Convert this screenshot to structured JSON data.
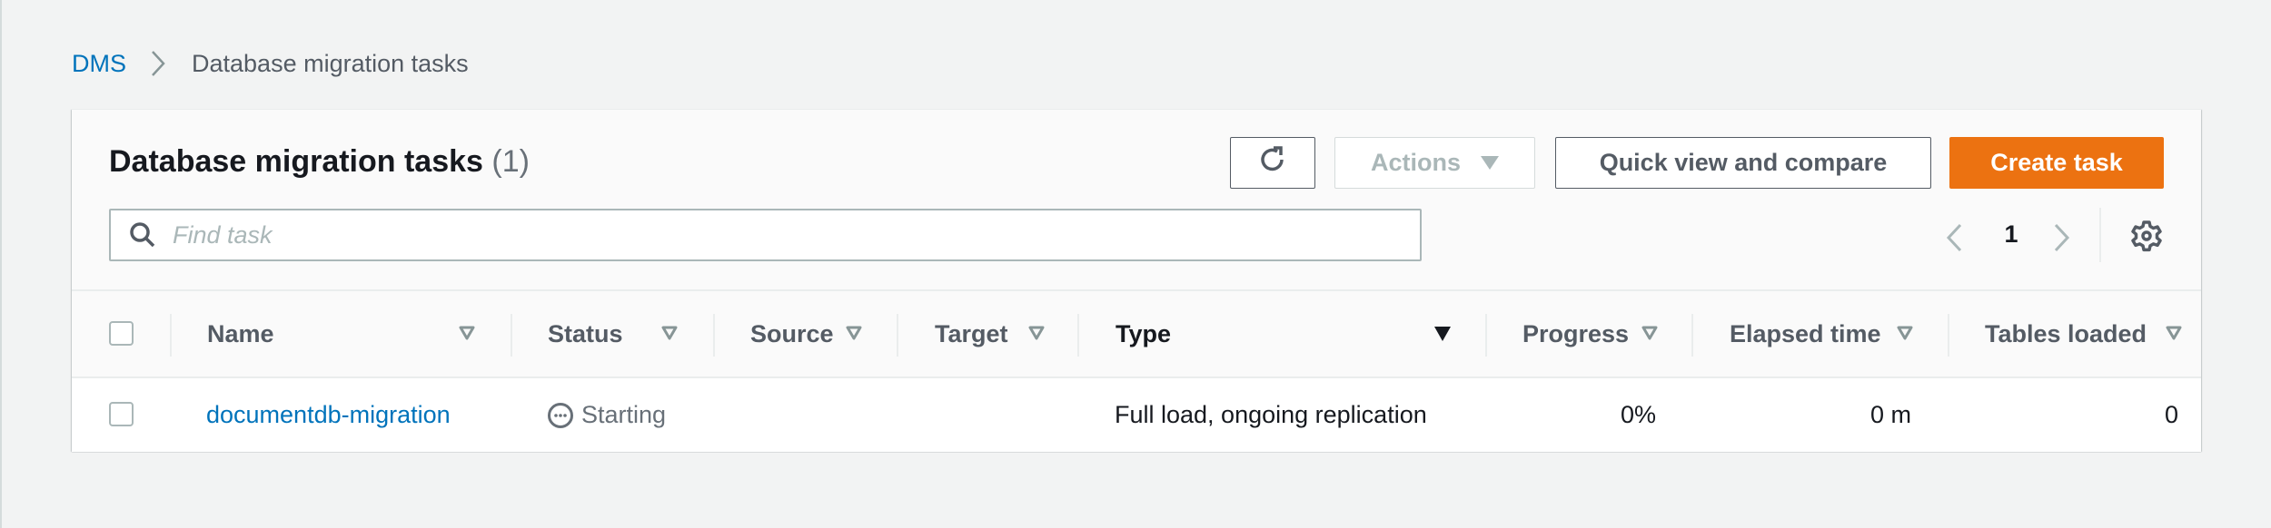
{
  "breadcrumb": {
    "items": [
      {
        "label": "DMS"
      },
      {
        "label": "Database migration tasks"
      }
    ]
  },
  "header": {
    "title": "Database migration tasks",
    "count": "(1)"
  },
  "toolbar": {
    "refresh_icon": "refresh-icon",
    "actions_label": "Actions",
    "quick_view_label": "Quick view and compare",
    "create_label": "Create task"
  },
  "search": {
    "placeholder": "Find task",
    "value": ""
  },
  "pagination": {
    "current_page": "1"
  },
  "table": {
    "columns": [
      {
        "label": "Name",
        "sort": "unsorted"
      },
      {
        "label": "Status",
        "sort": "unsorted"
      },
      {
        "label": "Source",
        "sort": "unsorted"
      },
      {
        "label": "Target",
        "sort": "unsorted"
      },
      {
        "label": "Type",
        "sort": "descending"
      },
      {
        "label": "Progress",
        "sort": "unsorted"
      },
      {
        "label": "Elapsed time",
        "sort": "unsorted"
      },
      {
        "label": "Tables loaded",
        "sort": "unsorted"
      }
    ],
    "rows": [
      {
        "name": "documentdb-migration",
        "status": "Starting",
        "status_icon": "status-pending-icon",
        "source": "",
        "target": "",
        "type": "Full load, ongoing replication",
        "progress": "0%",
        "elapsed_time": "0 m",
        "tables_loaded": "0"
      }
    ]
  },
  "colors": {
    "link": "#0073bb",
    "primary_button": "#ec7211",
    "text_dark": "#16191f",
    "text_secondary": "#545b64",
    "disabled": "#aab7b8"
  }
}
